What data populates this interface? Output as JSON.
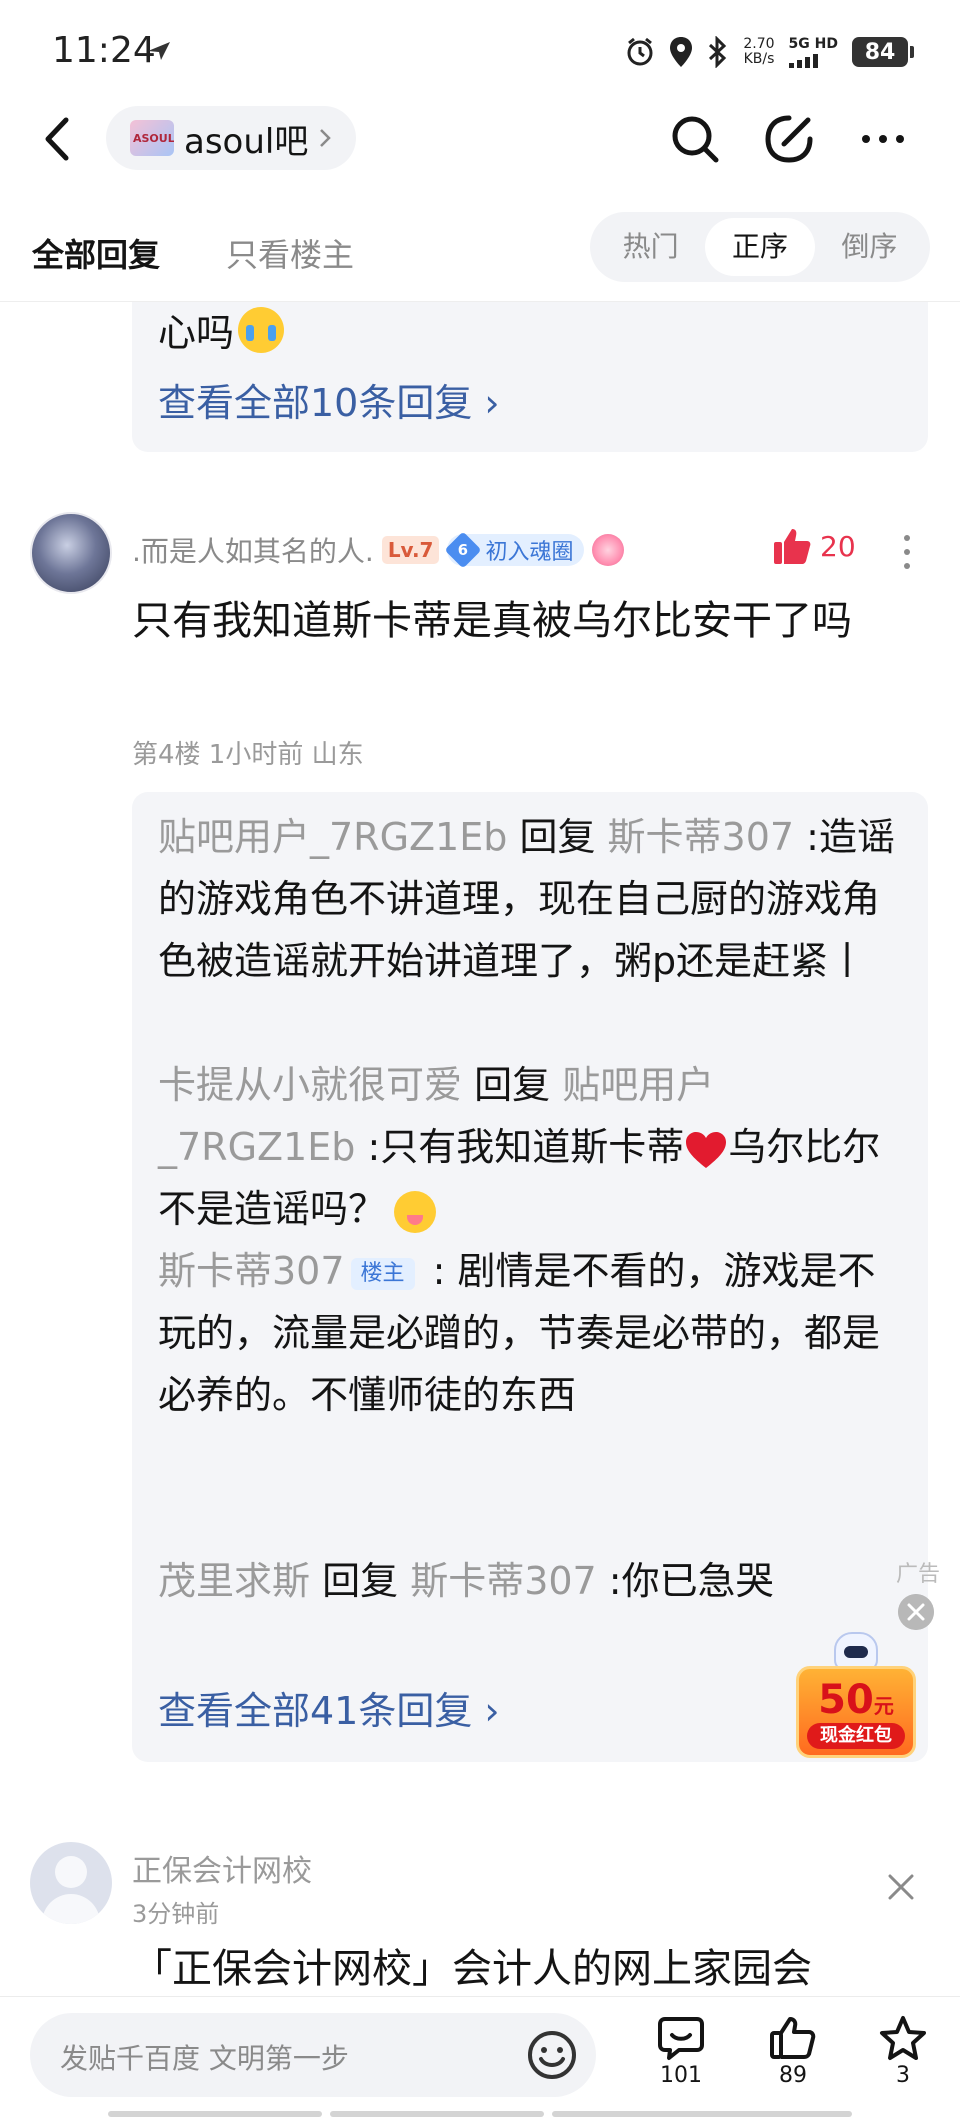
{
  "status_bar": {
    "time": "11:24",
    "net_speed_value": "2.70",
    "net_speed_unit": "KB/s",
    "network": "5G HD",
    "battery": "84"
  },
  "nav": {
    "forum_name": "asoul吧",
    "forum_logo_text": "ASOUL"
  },
  "tabs": {
    "all_replies": "全部回复",
    "owner_only": "只看楼主",
    "sort_options": [
      "热门",
      "正序",
      "倒序"
    ],
    "active_sort": "正序"
  },
  "prev_reply": {
    "text_tail": "心吗",
    "view_all": "查看全部10条回复 ›"
  },
  "post": {
    "username": ".而是人如其名的人.",
    "level": "Lv.7",
    "badge_level": "6",
    "badge_text": "初入魂圈",
    "like_count": "20",
    "body": "只有我知道斯卡蒂是真被乌尔比安干了吗",
    "meta": "第4楼 1小时前 山东",
    "replies": [
      {
        "from": "贴吧用户_7RGZ1Eb",
        "verb": " 回复 ",
        "to": "斯卡蒂307",
        "text": " :造谣的游戏角色不讲道理，现在自己厨的游戏角色被造谣就开始讲道理了，粥p还是赶紧丨"
      },
      {
        "from": "卡提从小就很可爱",
        "verb": " 回复 ",
        "to": "贴吧用户_7RGZ1Eb",
        "text_a": " :只有我知道斯卡蒂",
        "text_b": "乌尔比尔不是造谣吗？"
      },
      {
        "from": "斯卡蒂307",
        "host_tag": "楼主",
        "text": " : 剧情是不看的，游戏是不玩的，流量是必蹭的，节奏是必带的，都是必养的。不懂师徒的东西"
      },
      {
        "from": "茂里求斯",
        "verb": " 回复 ",
        "to": "斯卡蒂307",
        "text": " :你已急哭"
      }
    ],
    "view_all": "查看全部41条回复 ›"
  },
  "ad_float": {
    "label": "广告",
    "amount": "50",
    "unit": "元",
    "tag": "现金红包"
  },
  "ad_post": {
    "name": "正保会计网校",
    "time": "3分钟前",
    "title": "「正保会计网校」会计人的网上家园会"
  },
  "bottom_bar": {
    "compose_placeholder": "发贴千百度 文明第一步",
    "comment_count": "101",
    "like_count": "89",
    "star_count": "3"
  },
  "colors": {
    "link_blue": "#3a5fa3",
    "like_red": "#e8334d",
    "reply_bg": "#f4f5f8",
    "muted_gray": "#9a9a9a"
  }
}
